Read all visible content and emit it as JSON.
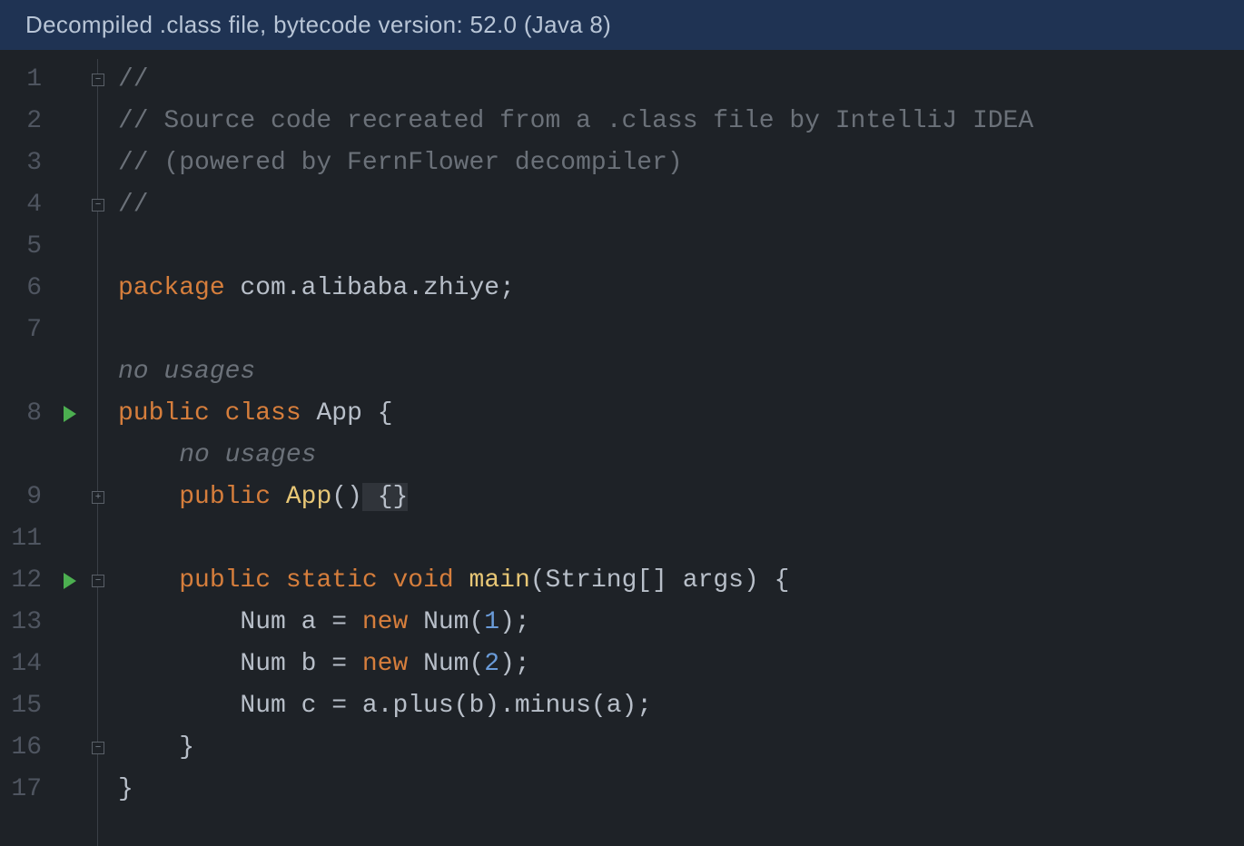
{
  "banner": {
    "text": "Decompiled .class file, bytecode version: 52.0 (Java 8)"
  },
  "lines": [
    {
      "num": "1",
      "run": false,
      "fold": "minus",
      "kind": "comment",
      "text": "//"
    },
    {
      "num": "2",
      "run": false,
      "fold": "",
      "kind": "comment",
      "text": "// Source code recreated from a .class file by IntelliJ IDEA"
    },
    {
      "num": "3",
      "run": false,
      "fold": "",
      "kind": "comment",
      "text": "// (powered by FernFlower decompiler)"
    },
    {
      "num": "4",
      "run": false,
      "fold": "minus",
      "kind": "comment",
      "text": "//"
    },
    {
      "num": "5",
      "run": false,
      "fold": "",
      "kind": "blank",
      "text": ""
    },
    {
      "num": "6",
      "run": false,
      "fold": "",
      "kind": "package",
      "kw": "package",
      "rest": " com.alibaba.zhiye;"
    },
    {
      "num": "7",
      "run": false,
      "fold": "",
      "kind": "blank",
      "text": ""
    },
    {
      "num": "",
      "run": false,
      "fold": "",
      "kind": "usage",
      "text": "no usages"
    },
    {
      "num": "8",
      "run": true,
      "fold": "",
      "kind": "classdecl",
      "kw1": "public",
      "kw2": "class",
      "cls": "App",
      "tail": " {"
    },
    {
      "num": "",
      "run": false,
      "fold": "",
      "kind": "usage-indent",
      "text": "no usages"
    },
    {
      "num": "9",
      "run": false,
      "fold": "plus",
      "kind": "ctor",
      "kw": "public",
      "name": "App",
      "paren": "()",
      "body": " {}"
    },
    {
      "num": "11",
      "run": false,
      "fold": "",
      "kind": "blank",
      "text": ""
    },
    {
      "num": "12",
      "run": true,
      "fold": "minus",
      "kind": "maindecl",
      "kw1": "public",
      "kw2": "static",
      "kw3": "void",
      "name": "main",
      "params": "(String[] args) {"
    },
    {
      "num": "13",
      "run": false,
      "fold": "",
      "kind": "newnum",
      "pre": "        Num a = ",
      "kw": "new",
      "mid": " Num(",
      "numv": "1",
      "tail": ");"
    },
    {
      "num": "14",
      "run": false,
      "fold": "",
      "kind": "newnum",
      "pre": "        Num b = ",
      "kw": "new",
      "mid": " Num(",
      "numv": "2",
      "tail": ");"
    },
    {
      "num": "15",
      "run": false,
      "fold": "",
      "kind": "plain",
      "text": "        Num c = a.plus(b).minus(a);"
    },
    {
      "num": "16",
      "run": false,
      "fold": "minus",
      "kind": "plain",
      "text": "    }"
    },
    {
      "num": "17",
      "run": false,
      "fold": "",
      "kind": "plain",
      "text": "}"
    }
  ]
}
